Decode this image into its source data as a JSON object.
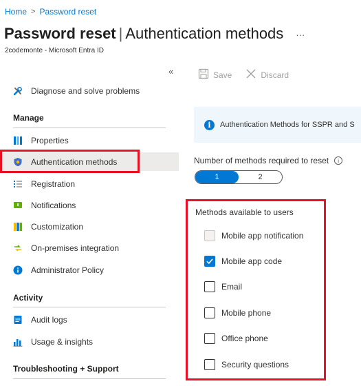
{
  "breadcrumb": {
    "home": "Home",
    "separator": ">",
    "current": "Password reset"
  },
  "header": {
    "title_bold": "Password reset",
    "title_pipe": "|",
    "title_rest": "Authentication methods",
    "more": "···",
    "subtitle": "2codemonte - Microsoft Entra ID"
  },
  "sidebar": {
    "collapse": "«",
    "diagnose": "Diagnose and solve problems",
    "sections": {
      "manage": "Manage",
      "activity": "Activity",
      "support": "Troubleshooting + Support"
    },
    "manage_items": [
      {
        "label": "Properties",
        "icon": "properties-icon"
      },
      {
        "label": "Authentication methods",
        "icon": "shield-icon",
        "active": true
      },
      {
        "label": "Registration",
        "icon": "list-icon"
      },
      {
        "label": "Notifications",
        "icon": "notifications-icon"
      },
      {
        "label": "Customization",
        "icon": "customization-icon"
      },
      {
        "label": "On-premises integration",
        "icon": "sync-icon"
      },
      {
        "label": "Administrator Policy",
        "icon": "info-icon"
      }
    ],
    "activity_items": [
      {
        "label": "Audit logs",
        "icon": "log-icon"
      },
      {
        "label": "Usage & insights",
        "icon": "chart-icon"
      }
    ]
  },
  "toolbar": {
    "save": "Save",
    "discard": "Discard"
  },
  "info": {
    "text": "Authentication Methods for SSPR and S"
  },
  "methods_required": {
    "label": "Number of methods required to reset",
    "options": [
      "1",
      "2"
    ],
    "selected": "1"
  },
  "methods": {
    "title": "Methods available to users",
    "items": [
      {
        "label": "Mobile app notification",
        "checked": false,
        "disabled": true
      },
      {
        "label": "Mobile app code",
        "checked": true,
        "disabled": false
      },
      {
        "label": "Email",
        "checked": false,
        "disabled": false
      },
      {
        "label": "Mobile phone",
        "checked": false,
        "disabled": false
      },
      {
        "label": "Office phone",
        "checked": false,
        "disabled": false
      },
      {
        "label": "Security questions",
        "checked": false,
        "disabled": false
      }
    ]
  },
  "colors": {
    "accent": "#0078d4",
    "highlight": "#e81123"
  }
}
